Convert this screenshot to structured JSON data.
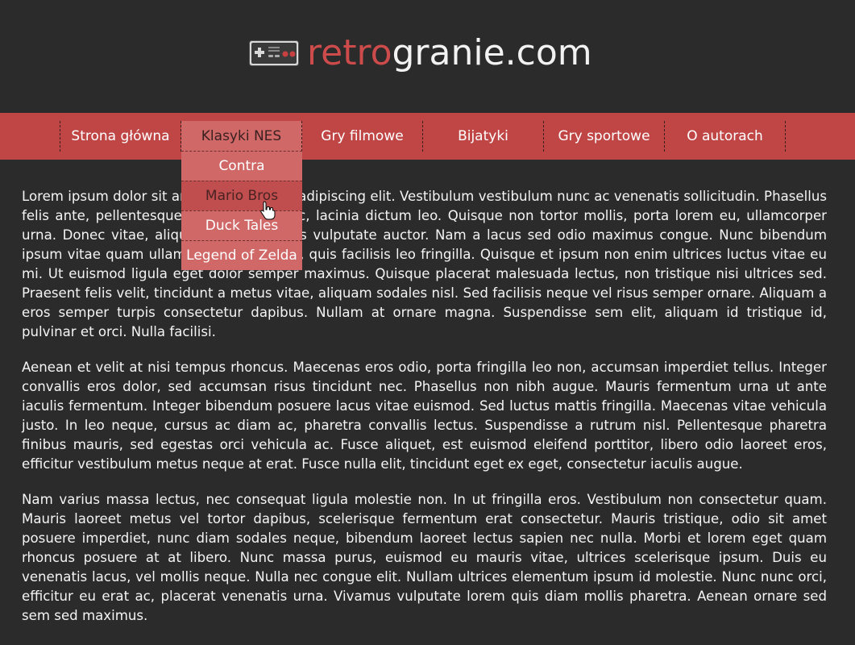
{
  "site": {
    "logo_part_red": "retro",
    "logo_part_white": "granie.com"
  },
  "nav": {
    "items": [
      "Strona główna",
      "Klasyki NES",
      "Gry filmowe",
      "Bijatyki",
      "Gry sportowe",
      "O autorach"
    ],
    "active_index": 1
  },
  "dropdown": {
    "items": [
      "Contra",
      "Mario Bros",
      "Duck Tales",
      "Legend of Zelda"
    ],
    "hover_index": 1
  },
  "content": {
    "paragraphs": [
      "Lorem ipsum dolor sit amet, consectetur adipiscing elit. Vestibulum vestibulum nunc ac venenatis sollicitudin. Phasellus felis ante, pellentesque eu neque mi nec, lacinia dictum leo. Quisque non tortor mollis, porta lorem eu, ullamcorper urna. Donec vitae, aliquam quis sed eros vulputate auctor. Nam a lacus sed odio maximus congue. Nunc bibendum ipsum vitae quam ullamcorper pharetrae, quis facilisis leo fringilla. Quisque et ipsum non enim ultrices luctus vitae eu mi. Ut euismod ligula eget dolor semper maximus. Quisque placerat malesuada lectus, non tristique nisi ultrices sed. Praesent felis velit, tincidunt a metus vitae, aliquam sodales nisl. Sed facilisis neque vel risus semper ornare. Aliquam a eros semper turpis consectetur dapibus. Nullam at ornare magna. Suspendisse sem elit, aliquam id tristique id, pulvinar et orci. Nulla facilisi.",
      "Aenean et velit at nisi tempus rhoncus. Maecenas eros odio, porta fringilla leo non, accumsan imperdiet tellus. Integer convallis eros dolor, sed accumsan risus tincidunt nec. Phasellus non nibh augue. Mauris fermentum urna ut ante iaculis fermentum. Integer bibendum posuere lacus vitae euismod. Sed luctus mattis fringilla. Maecenas vitae vehicula justo. In leo neque, cursus ac diam ac, pharetra convallis lectus. Suspendisse a rutrum nisl. Pellentesque pharetra finibus mauris, sed egestas orci vehicula ac. Fusce aliquet, est euismod eleifend porttitor, libero odio laoreet eros, efficitur vestibulum metus neque at erat. Fusce nulla elit, tincidunt eget ex eget, consectetur iaculis augue.",
      "Nam varius massa lectus, nec consequat ligula molestie non. In ut fringilla eros. Vestibulum non consectetur quam. Mauris laoreet metus vel tortor dapibus, scelerisque fermentum erat consectetur. Mauris tristique, odio sit amet posuere imperdiet, nunc diam sodales neque, bibendum laoreet lectus sapien nec nulla. Morbi et lorem eget quam rhoncus posuere at at libero. Nunc massa purus, euismod eu mauris vitae, ultrices scelerisque ipsum. Duis eu venenatis lacus, vel mollis neque. Nulla nec congue elit. Nullam ultrices elementum ipsum id molestie. Nunc nunc orci, efficitur eu erat ac, placerat venenatis urna. Vivamus vulputate lorem quis diam mollis pharetra. Aenean ornare sed sem sed maximus."
    ]
  },
  "colors": {
    "background": "#2b2b2c",
    "nav_bar": "#c04646",
    "nav_active": "#d06868",
    "logo_red": "#cd4b4b"
  },
  "icons": {
    "logo": "nes-controller-icon",
    "cursor": "hand-pointer-icon"
  }
}
